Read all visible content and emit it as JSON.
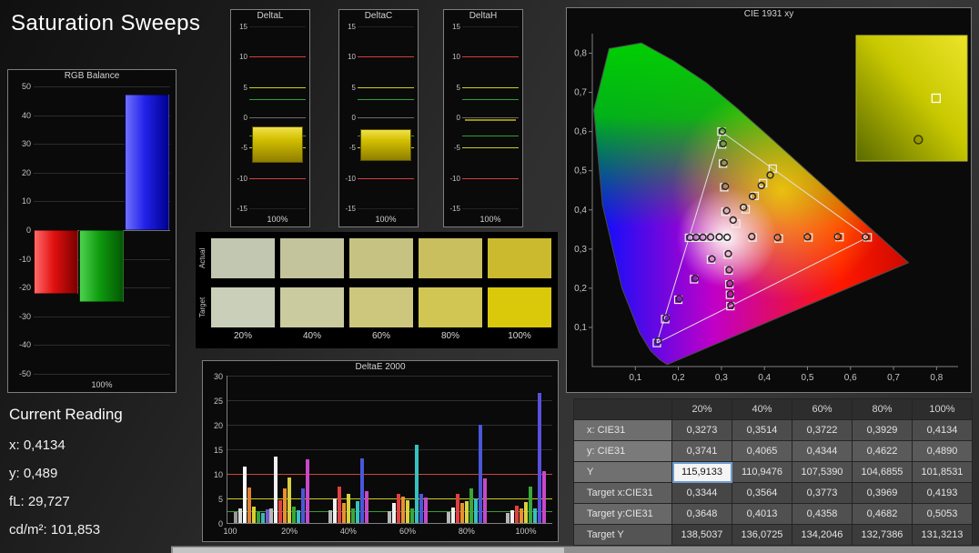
{
  "page": {
    "title": "Saturation Sweeps"
  },
  "current_reading": {
    "title": "Current Reading",
    "lines": [
      "x: 0,4134",
      "y: 0,489",
      "fL: 29,727",
      "cd/m²: 101,853"
    ]
  },
  "colors": {
    "limit_red": "#d24040",
    "limit_yellow": "#cdcd20",
    "limit_green": "#2f9f2f",
    "axis": "#808080",
    "grid": "#2c2c2c"
  },
  "chart_data": [
    {
      "id": "rgb_balance",
      "type": "bar",
      "title": "RGB Balance",
      "categories": [
        "Red",
        "Green",
        "Blue"
      ],
      "values": [
        -22,
        -25,
        47
      ],
      "ylim": [
        -50,
        50
      ],
      "yticks": [
        50,
        40,
        30,
        20,
        10,
        0,
        -10,
        -20,
        -30,
        -40,
        -50
      ],
      "xlabel": "100%"
    },
    {
      "id": "delta_l",
      "type": "bar",
      "title": "DeltaL",
      "ylim": [
        -15,
        15
      ],
      "yticks": [
        15,
        10,
        5,
        0,
        -5,
        -10,
        -15
      ],
      "xlabel": "100%",
      "bar_top": -1.5,
      "bar_bottom": -7.5,
      "limits": {
        "red": 10,
        "yellow": 5,
        "green": 3
      }
    },
    {
      "id": "delta_c",
      "type": "bar",
      "title": "DeltaC",
      "ylim": [
        -15,
        15
      ],
      "yticks": [
        15,
        10,
        5,
        0,
        -5,
        -10,
        -15
      ],
      "xlabel": "100%",
      "bar_top": -2.0,
      "bar_bottom": -7.2,
      "limits": {
        "red": 10,
        "yellow": 5,
        "green": 3
      }
    },
    {
      "id": "delta_h",
      "type": "line",
      "title": "DeltaH",
      "ylim": [
        -15,
        15
      ],
      "yticks": [
        15,
        10,
        5,
        0,
        -5,
        -10,
        -15
      ],
      "xlabel": "100%",
      "line_value": -0.4,
      "limits": {
        "red": 10,
        "yellow": 5,
        "green": 3
      }
    },
    {
      "id": "delta_e_2000",
      "type": "bar",
      "title": "DeltaE 2000",
      "ylim": [
        0,
        30
      ],
      "yticks": [
        30,
        25,
        20,
        15,
        10,
        5,
        0
      ],
      "x_ticks": [
        "100",
        "20%",
        "40%",
        "60%",
        "80%",
        "100%"
      ],
      "limits": {
        "red": 10,
        "yellow": 5,
        "green": 2.5
      },
      "groups": [
        {
          "bars": [
            [
              "#9a9a9a",
              2.3
            ],
            [
              "#d8d8d8",
              2.9
            ],
            [
              "#ffffff",
              11.5
            ],
            [
              "#e08030",
              7.2
            ],
            [
              "#d8d030",
              3.4
            ],
            [
              "#38a038",
              2.3
            ],
            [
              "#38b8b8",
              2.0
            ],
            [
              "#7858c8",
              2.7
            ]
          ]
        },
        {
          "bars": [
            [
              "#b8b8b8",
              3.0
            ],
            [
              "#f0f0f0",
              13.5
            ],
            [
              "#e04040",
              4.6
            ],
            [
              "#e89030",
              7.0
            ],
            [
              "#d8d040",
              9.3
            ],
            [
              "#38a838",
              3.4
            ],
            [
              "#38c0c0",
              2.6
            ],
            [
              "#4858d8",
              7.0
            ],
            [
              "#c848c8",
              13.0
            ]
          ]
        },
        {
          "bars": [
            [
              "#b8b8b8",
              2.6
            ],
            [
              "#f0f0f0",
              5.0
            ],
            [
              "#e04040",
              7.5
            ],
            [
              "#e89030",
              4.0
            ],
            [
              "#d8d040",
              6.0
            ],
            [
              "#38a838",
              3.0
            ],
            [
              "#38c0c0",
              4.4
            ],
            [
              "#4858d8",
              13.2
            ],
            [
              "#c848c8",
              6.4
            ]
          ]
        },
        {
          "bars": [
            [
              "#b8b8b8",
              2.4
            ],
            [
              "#f0f0f0",
              4.0
            ],
            [
              "#e04040",
              6.0
            ],
            [
              "#e89030",
              5.4
            ],
            [
              "#d8d040",
              4.6
            ],
            [
              "#38a838",
              3.0
            ],
            [
              "#38c0c0",
              16.0
            ],
            [
              "#4858d8",
              6.0
            ],
            [
              "#c848c8",
              5.2
            ]
          ]
        },
        {
          "bars": [
            [
              "#b8b8b8",
              2.2
            ],
            [
              "#f0f0f0",
              3.2
            ],
            [
              "#e04040",
              6.0
            ],
            [
              "#e89030",
              4.0
            ],
            [
              "#d8d040",
              4.4
            ],
            [
              "#38a838",
              7.0
            ],
            [
              "#38c0c0",
              5.0
            ],
            [
              "#4858d8",
              20.0
            ],
            [
              "#c848c8",
              9.0
            ]
          ]
        },
        {
          "bars": [
            [
              "#b8b8b8",
              2.0
            ],
            [
              "#f0f0f0",
              2.6
            ],
            [
              "#e04040",
              3.6
            ],
            [
              "#e89030",
              3.0
            ],
            [
              "#d8d040",
              4.2
            ],
            [
              "#38a838",
              7.5
            ],
            [
              "#38c0c0",
              3.0
            ],
            [
              "#5850e0",
              26.5
            ],
            [
              "#c848c8",
              10.5
            ]
          ]
        }
      ]
    },
    {
      "id": "cie_1931",
      "type": "scatter",
      "title": "CIE 1931 xy",
      "x_ticks": [
        "0,1",
        "0,2",
        "0,3",
        "0,4",
        "0,5",
        "0,6",
        "0,7",
        "0,8"
      ],
      "y_ticks": [
        "0,8",
        "0,7",
        "0,6",
        "0,5",
        "0,4",
        "0,3",
        "0,2",
        "0,1"
      ],
      "axis_max": 0.85,
      "gamut_triangle": [
        [
          0.64,
          0.33
        ],
        [
          0.3,
          0.6
        ],
        [
          0.15,
          0.06
        ]
      ],
      "target_points": [
        [
          0.3127,
          0.329
        ],
        [
          0.3344,
          0.3648
        ],
        [
          0.3564,
          0.4013
        ],
        [
          0.3773,
          0.4358
        ],
        [
          0.3969,
          0.4682
        ],
        [
          0.4193,
          0.5053
        ],
        [
          0.3725,
          0.3294
        ],
        [
          0.4334,
          0.3267
        ],
        [
          0.5025,
          0.3297
        ],
        [
          0.5746,
          0.3304
        ],
        [
          0.64,
          0.33
        ],
        [
          0.3095,
          0.3952
        ],
        [
          0.3064,
          0.4578
        ],
        [
          0.3036,
          0.5183
        ],
        [
          0.3015,
          0.5672
        ],
        [
          0.3,
          0.6
        ],
        [
          0.2758,
          0.2733
        ],
        [
          0.2363,
          0.2229
        ],
        [
          0.1998,
          0.1706
        ],
        [
          0.1693,
          0.1211
        ],
        [
          0.15,
          0.06
        ],
        [
          0.2926,
          0.3289
        ],
        [
          0.2726,
          0.3289
        ],
        [
          0.2544,
          0.3289
        ],
        [
          0.2384,
          0.3288
        ],
        [
          0.2246,
          0.3287
        ],
        [
          0.3146,
          0.2862
        ],
        [
          0.3167,
          0.2453
        ],
        [
          0.3186,
          0.21
        ],
        [
          0.3199,
          0.183
        ],
        [
          0.3209,
          0.1542
        ]
      ],
      "measured_points": [
        [
          0.3134,
          0.33
        ],
        [
          0.3273,
          0.3741
        ],
        [
          0.3514,
          0.4065
        ],
        [
          0.3722,
          0.4344
        ],
        [
          0.3929,
          0.4622
        ],
        [
          0.4134,
          0.489
        ],
        [
          0.3706,
          0.332
        ],
        [
          0.4305,
          0.3295
        ],
        [
          0.4998,
          0.3312
        ],
        [
          0.5702,
          0.3318
        ],
        [
          0.6352,
          0.331
        ],
        [
          0.3122,
          0.398
        ],
        [
          0.309,
          0.4602
        ],
        [
          0.3061,
          0.52
        ],
        [
          0.304,
          0.569
        ],
        [
          0.3022,
          0.601
        ],
        [
          0.278,
          0.275
        ],
        [
          0.239,
          0.225
        ],
        [
          0.202,
          0.173
        ],
        [
          0.1715,
          0.124
        ],
        [
          0.153,
          0.065
        ],
        [
          0.295,
          0.331
        ],
        [
          0.275,
          0.3305
        ],
        [
          0.257,
          0.33
        ],
        [
          0.241,
          0.33
        ],
        [
          0.227,
          0.3295
        ],
        [
          0.316,
          0.288
        ],
        [
          0.318,
          0.247
        ],
        [
          0.3198,
          0.212
        ],
        [
          0.321,
          0.185
        ],
        [
          0.322,
          0.156
        ]
      ],
      "inset": {
        "square": [
          0.72,
          0.5
        ],
        "circle": [
          0.56,
          0.83
        ]
      }
    }
  ],
  "swatches": {
    "row_labels": [
      "Actual",
      "Target"
    ],
    "col_labels": [
      "20%",
      "40%",
      "60%",
      "80%",
      "100%"
    ],
    "actual_colors": [
      "#c1c7b0",
      "#c3c49c",
      "#c6c282",
      "#cabf5e",
      "#cbba2e"
    ],
    "target_colors": [
      "#c9cfb8",
      "#cacb9e",
      "#cdc77e",
      "#d1c654",
      "#dac90a"
    ]
  },
  "table": {
    "col_headers": [
      "20%",
      "40%",
      "60%",
      "80%",
      "100%"
    ],
    "rows": [
      {
        "label": "x: CIE31",
        "kind": "measured",
        "values": [
          "0,3273",
          "0,3514",
          "0,3722",
          "0,3929",
          "0,4134"
        ]
      },
      {
        "label": "y: CIE31",
        "kind": "measured",
        "values": [
          "0,3741",
          "0,4065",
          "0,4344",
          "0,4622",
          "0,4890"
        ]
      },
      {
        "label": "Y",
        "kind": "measured",
        "highlight_col": 0,
        "values": [
          "115,9133",
          "110,9476",
          "107,5390",
          "104,6855",
          "101,8531"
        ]
      },
      {
        "label": "Target x:CIE31",
        "kind": "target",
        "values": [
          "0,3344",
          "0,3564",
          "0,3773",
          "0,3969",
          "0,4193"
        ]
      },
      {
        "label": "Target y:CIE31",
        "kind": "target",
        "values": [
          "0,3648",
          "0,4013",
          "0,4358",
          "0,4682",
          "0,5053"
        ]
      },
      {
        "label": "Target Y",
        "kind": "target",
        "values": [
          "138,5037",
          "136,0725",
          "134,2046",
          "132,7386",
          "131,3213"
        ]
      }
    ]
  }
}
